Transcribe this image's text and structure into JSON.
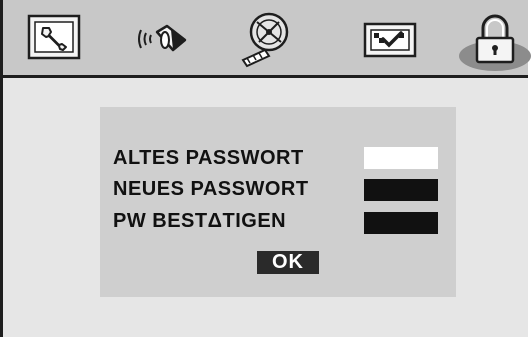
{
  "menu": {
    "tabs": [
      {
        "id": "settings",
        "icon": "wrench-icon",
        "selected": false
      },
      {
        "id": "audio",
        "icon": "speaker-icon",
        "selected": false
      },
      {
        "id": "video",
        "icon": "film-reel-icon",
        "selected": false
      },
      {
        "id": "preferences",
        "icon": "checkmark-board-icon",
        "selected": false
      },
      {
        "id": "password",
        "icon": "padlock-icon",
        "selected": true
      }
    ]
  },
  "password_dialog": {
    "old_password_label": "ALTES PASSWORT",
    "new_password_label": "NEUES PASSWORT",
    "confirm_password_label": "PW BESTΔTIGEN",
    "ok_label": "OK"
  },
  "colors": {
    "background": "#e6e6e6",
    "topbar": "#c8c8c8",
    "panel": "#cfcfcf",
    "active_field": "#ffffff",
    "inactive_field": "#111111"
  }
}
